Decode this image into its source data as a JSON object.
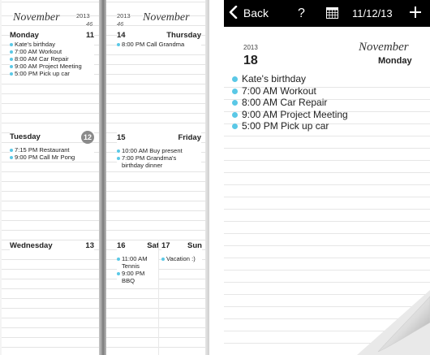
{
  "week": {
    "month": "November",
    "year_left": "2013",
    "week_number": "46",
    "year_right": "2013",
    "week_number_right": "46",
    "days": {
      "monday": {
        "name": "Monday",
        "num": "11",
        "events": [
          "Kate's birthday",
          "7:00 AM Workout",
          "8:00 AM Car Repair",
          "9:00 AM Project Meeting",
          "5:00 PM Pick up car"
        ]
      },
      "tuesday": {
        "name": "Tuesday",
        "num": "12",
        "events": [
          "7:15 PM Restaurant",
          "9:00 PM Call Mr Pong"
        ]
      },
      "wednesday": {
        "name": "Wednesday",
        "num": "13",
        "events": []
      },
      "thursday": {
        "name": "Thursday",
        "num": "14",
        "events": [
          "8:00 PM Call Grandma"
        ]
      },
      "friday": {
        "name": "Friday",
        "num": "15",
        "events": [
          "10:00 AM Buy present",
          "7:00 PM Grandma's",
          "birthday dinner"
        ]
      },
      "saturday": {
        "name": "Sat",
        "num": "16",
        "events": [
          "11:00 AM",
          "Tennis",
          "9:00 PM",
          "BBQ"
        ]
      },
      "sunday": {
        "name": "Sun",
        "num": "17",
        "events": [
          "Vacation :)"
        ]
      }
    }
  },
  "dayview": {
    "toolbar": {
      "back_label": "Back",
      "help_label": "?",
      "date_label": "11/12/13",
      "add_label": "+"
    },
    "year": "2013",
    "month": "November",
    "day_num": "18",
    "day_name": "Monday",
    "events": [
      "Kate's birthday",
      "7:00 AM Workout",
      "8:00 AM Car Repair",
      "9:00 AM Project Meeting",
      "5:00 PM Pick up car"
    ]
  },
  "colors": {
    "event_dot": "#5ac8e6",
    "toolbar_bg": "#000000",
    "today_badge": "#8a8a8a"
  },
  "icons": {
    "back": "chevron-left-icon",
    "help": "question-icon",
    "calendar": "calendar-grid-icon",
    "add": "plus-icon"
  }
}
